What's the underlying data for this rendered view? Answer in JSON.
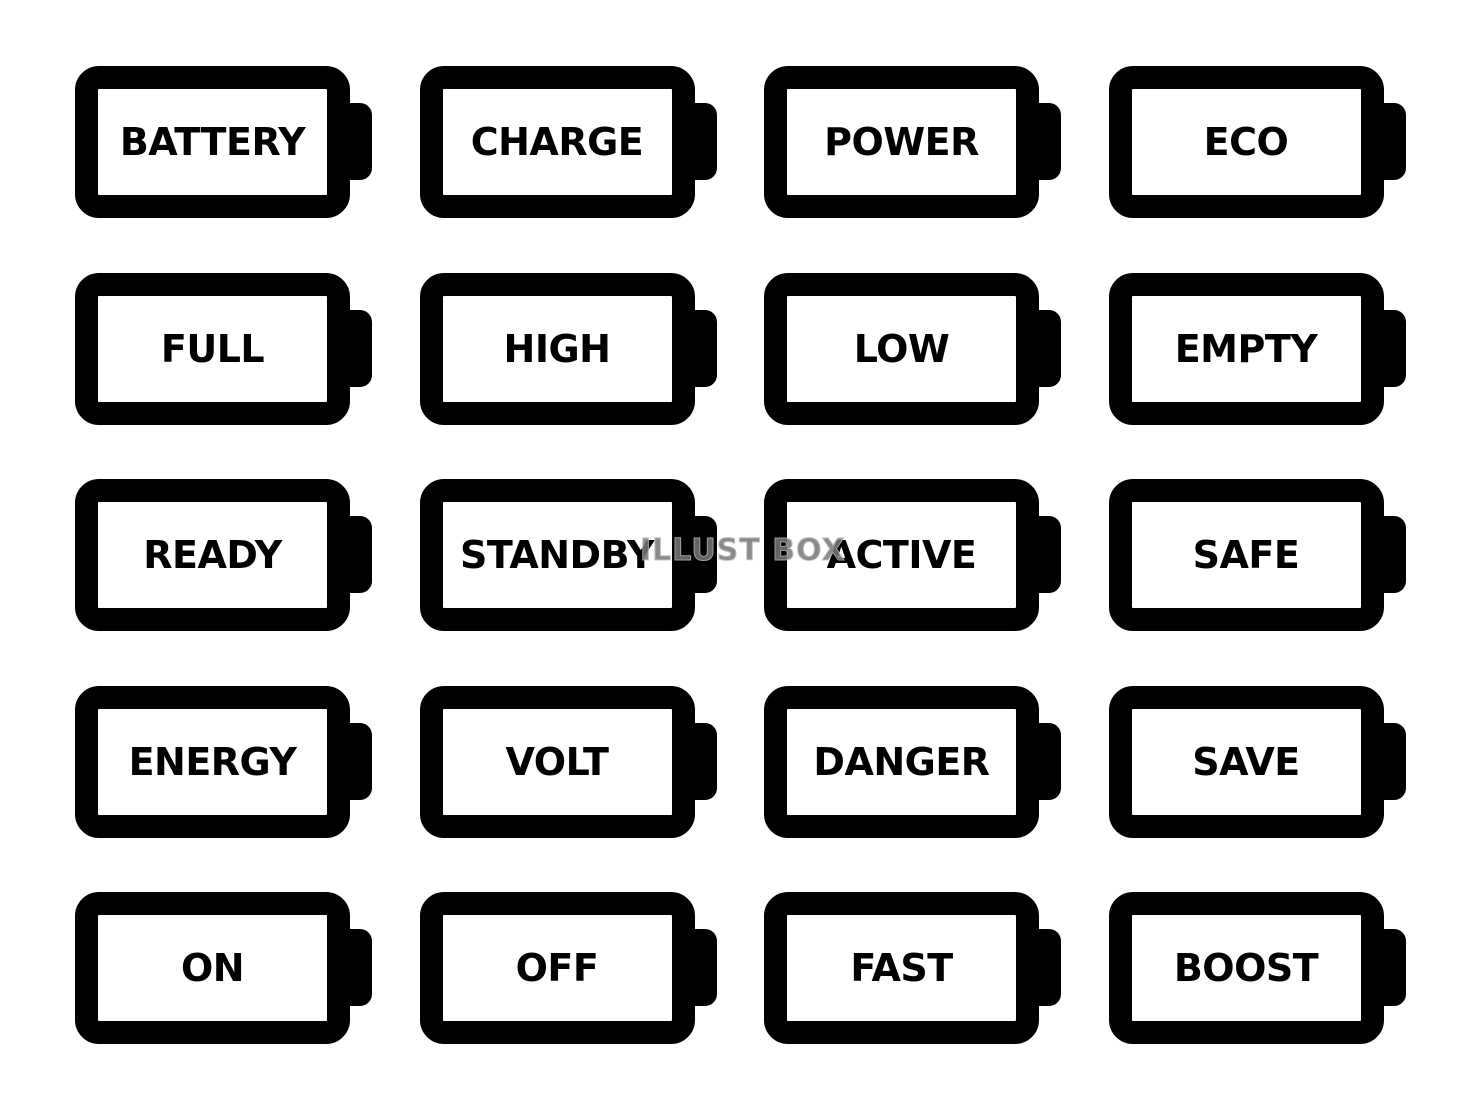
{
  "labels": [
    "BATTERY",
    "CHARGE",
    "POWER",
    "ECO",
    "FULL",
    "HIGH",
    "LOW",
    "EMPTY",
    "READY",
    "STANDBY",
    "ACTIVE",
    "SAFE",
    "ENERGY",
    "VOLT",
    "DANGER",
    "SAVE",
    "ON",
    "OFF",
    "FAST",
    "BOOST"
  ],
  "watermark": "ILLUST BOX",
  "colors": {
    "icon": "#000000",
    "background": "#ffffff",
    "watermark": "#777777"
  }
}
